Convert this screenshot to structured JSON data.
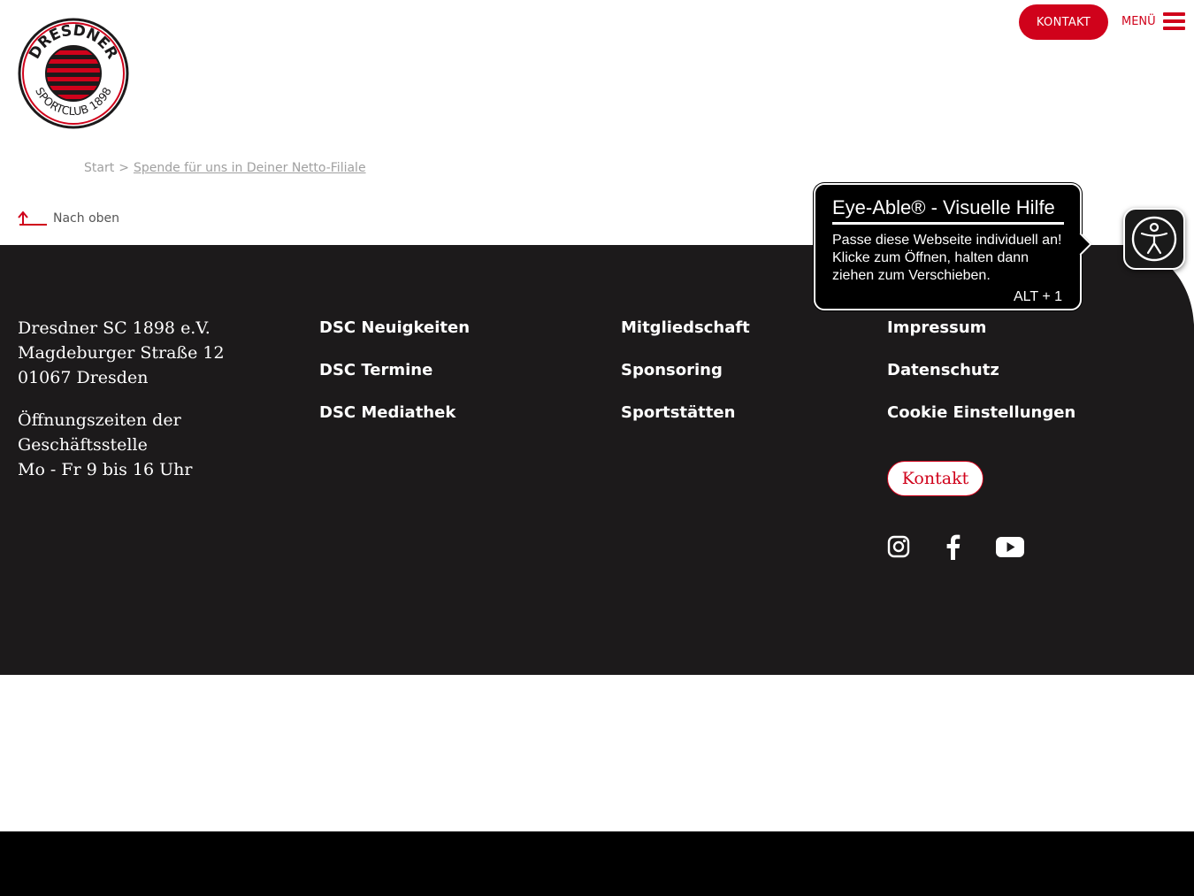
{
  "header": {
    "logo_top_text": "DRESDNER",
    "logo_bottom_text": "SPORTCLUB 1898",
    "kontakt_label": "KONTAKT",
    "menu_label": "MENÜ"
  },
  "breadcrumb": {
    "start": "Start",
    "separator": ">",
    "current": "Spende für uns in Deiner Netto-Filiale"
  },
  "back_to_top": "Nach oben",
  "footer": {
    "address": {
      "name": "Dresdner SC 1898 e.V.",
      "street": "Magdeburger Straße 12",
      "city": "01067 Dresden"
    },
    "hours": {
      "line1": "Öffnungszeiten der",
      "line2": "Geschäftsstelle",
      "line3": "Mo - Fr 9 bis 16 Uhr"
    },
    "col2": [
      "DSC Neuigkeiten",
      "DSC Termine",
      "DSC Mediathek"
    ],
    "col3": [
      "Mitgliedschaft",
      "Sponsoring",
      "Sportstätten"
    ],
    "col4": [
      "Impressum",
      "Datenschutz",
      "Cookie Einstellungen"
    ],
    "kontakt_button": "Kontakt",
    "social_icons": [
      "instagram-icon",
      "facebook-icon",
      "youtube-icon"
    ]
  },
  "eye_able": {
    "title": "Eye-Able® - Visuelle Hilfe",
    "text": "Passe diese Webseite individuell an! Klicke zum Öffnen, halten dann ziehen zum Verschieben.",
    "shortcut": "ALT + 1"
  },
  "colors": {
    "accent": "#d0021b",
    "footer_bg": "#1c1a1b",
    "bottom_bar": "#000000"
  }
}
